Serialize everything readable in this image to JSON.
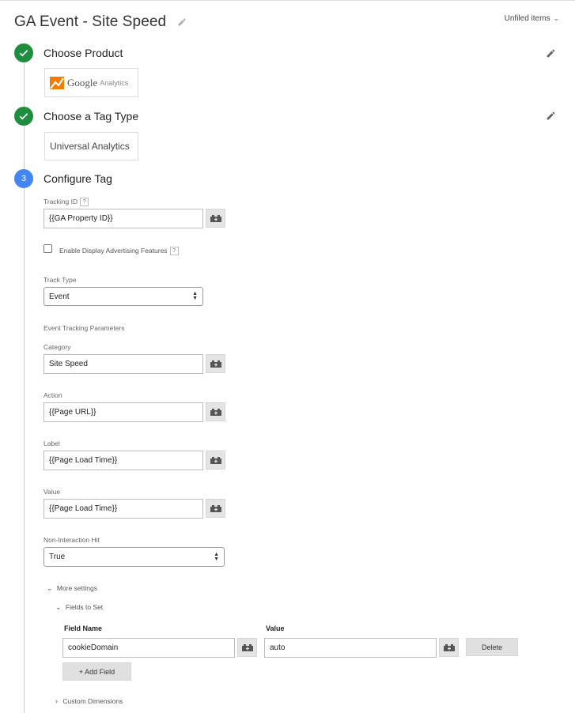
{
  "header": {
    "title": "GA Event - Site Speed",
    "unfiled": "Unfiled items"
  },
  "steps": [
    {
      "number": "",
      "title": "Choose Product",
      "status": "done"
    },
    {
      "number": "",
      "title": "Choose a Tag Type",
      "status": "done"
    },
    {
      "number": "3",
      "title": "Configure Tag",
      "status": "active"
    }
  ],
  "product": {
    "name": "Google",
    "sub": "Analytics"
  },
  "tag_type": "Universal Analytics",
  "form": {
    "tracking_id_label": "Tracking ID",
    "tracking_id_value": "{{GA Property ID}}",
    "display_adv_label": "Enable Display Advertising Features",
    "track_type_label": "Track Type",
    "track_type_value": "Event",
    "event_params_heading": "Event Tracking Parameters",
    "category_label": "Category",
    "category_value": "Site Speed",
    "action_label": "Action",
    "action_value": "{{Page URL}}",
    "label_label": "Label",
    "label_value": "{{Page Load Time}}",
    "value_label": "Value",
    "value_value": "{{Page Load Time}}",
    "non_interaction_label": "Non-Interaction Hit",
    "non_interaction_value": "True"
  },
  "more_settings": {
    "label": "More settings",
    "fields_to_set": "Fields to Set",
    "field_name_header": "Field Name",
    "value_header": "Value",
    "row_field": "cookieDomain",
    "row_value": "auto",
    "delete_label": "Delete",
    "add_field_label": "+ Add Field",
    "custom_dimensions": "Custom Dimensions"
  },
  "help_mark": "?",
  "colors": {
    "done": "#1e8e3e",
    "active": "#4285f4",
    "ga_orange": "#f57c00"
  }
}
